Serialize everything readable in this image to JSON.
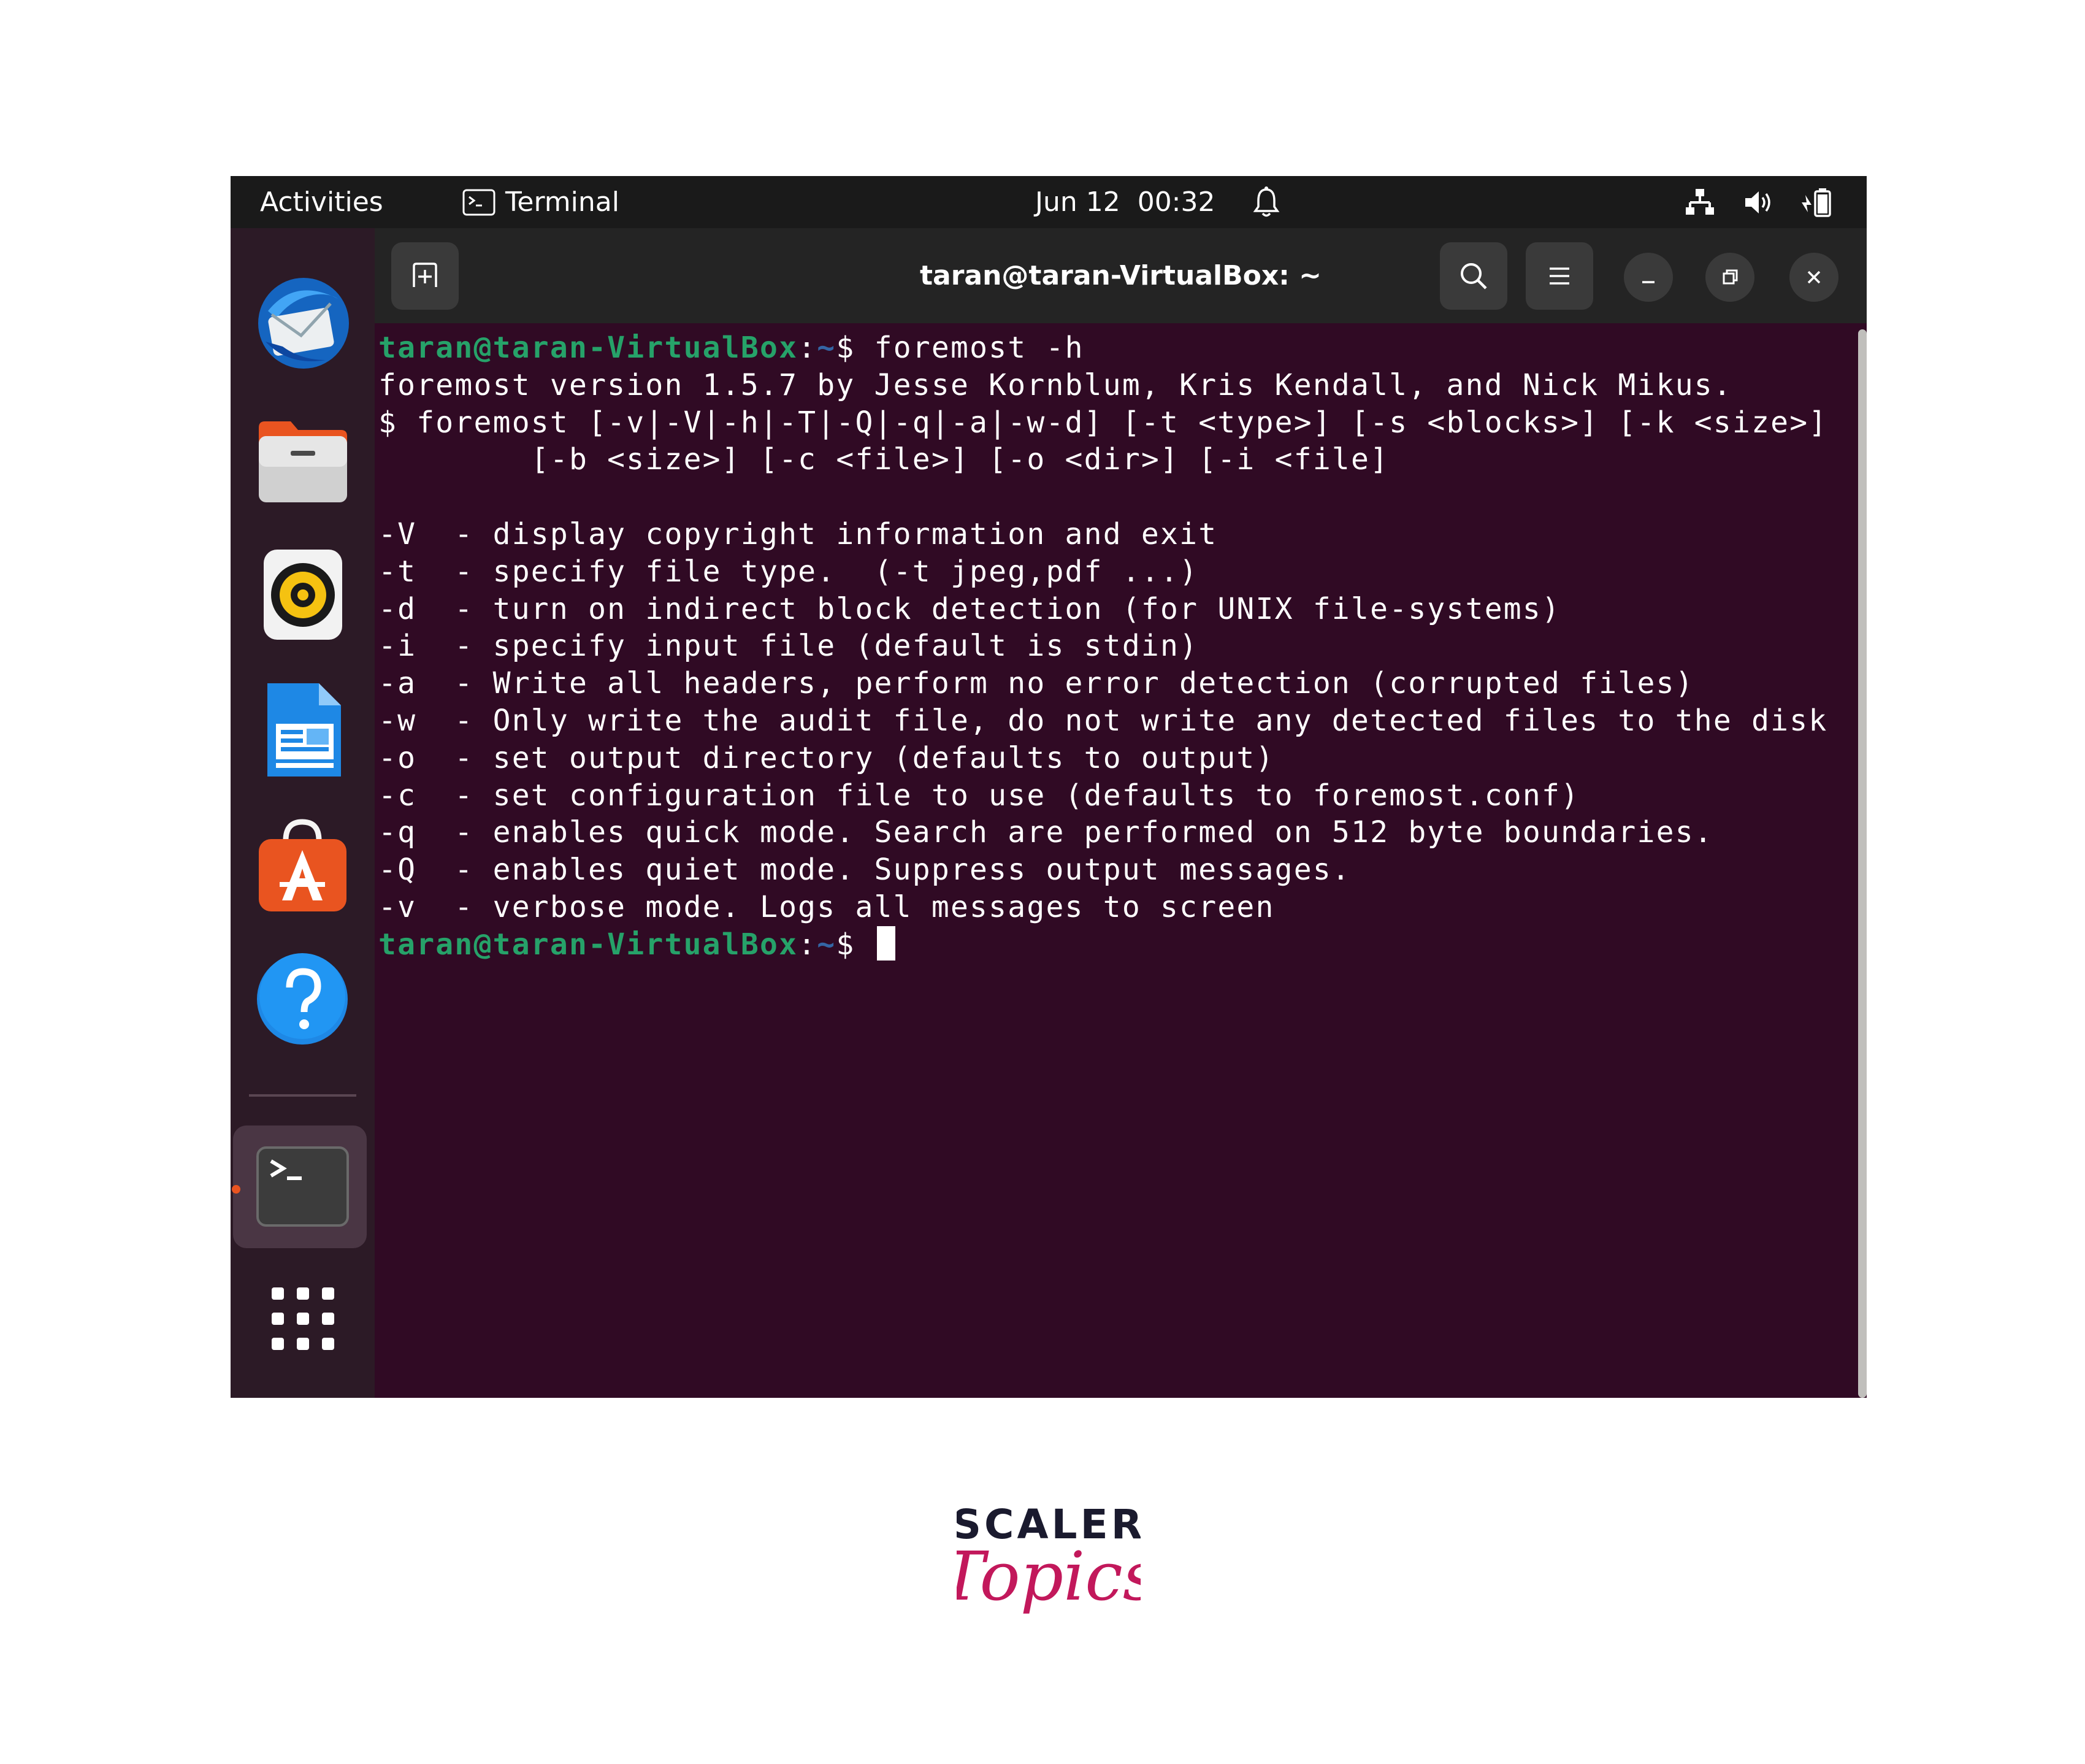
{
  "topbar": {
    "activities": "Activities",
    "app_name": "Terminal",
    "datetime": "Jun 12  00:32",
    "icons": [
      "terminal-icon",
      "alarm-bell-icon",
      "network-icon",
      "volume-icon",
      "battery-icon"
    ]
  },
  "dock": {
    "items": [
      "thunderbird-mail-icon",
      "files-folder-icon",
      "rhythmbox-speaker-icon",
      "libreoffice-writer-icon",
      "app-center-icon",
      "help-icon",
      "terminal-app-icon",
      "show-apps-grid-icon"
    ]
  },
  "window": {
    "title": "taran@taran-VirtualBox: ~",
    "buttons": [
      "new-tab",
      "search",
      "menu",
      "minimize",
      "restore",
      "close"
    ]
  },
  "terminal": {
    "prompt_user": "taran@taran-VirtualBox",
    "prompt_sep": ":",
    "prompt_path": "~",
    "prompt_char": "$",
    "command": " foremost -h",
    "output": [
      "foremost version 1.5.7 by Jesse Kornblum, Kris Kendall, and Nick Mikus.",
      "$ foremost [-v|-V|-h|-T|-Q|-q|-a|-w-d] [-t <type>] [-s <blocks>] [-k <size>]",
      "        [-b <size>] [-c <file>] [-o <dir>] [-i <file]",
      "",
      "-V  - display copyright information and exit",
      "-t  - specify file type.  (-t jpeg,pdf ...)",
      "-d  - turn on indirect block detection (for UNIX file-systems)",
      "-i  - specify input file (default is stdin)",
      "-a  - Write all headers, perform no error detection (corrupted files)",
      "-w  - Only write the audit file, do not write any detected files to the disk",
      "-o  - set output directory (defaults to output)",
      "-c  - set configuration file to use (defaults to foremost.conf)",
      "-q  - enables quick mode. Search are performed on 512 byte boundaries.",
      "-Q  - enables quiet mode. Suppress output messages.",
      "-v  - verbose mode. Logs all messages to screen"
    ]
  },
  "logo": {
    "line1": "SCALER",
    "line2": "Topics"
  },
  "colors": {
    "terminal_bg": "#300a24",
    "prompt_user": "#26a269",
    "prompt_path": "#3465a4",
    "logo_dark": "#1a1a2e",
    "logo_pink": "#c2185b"
  }
}
